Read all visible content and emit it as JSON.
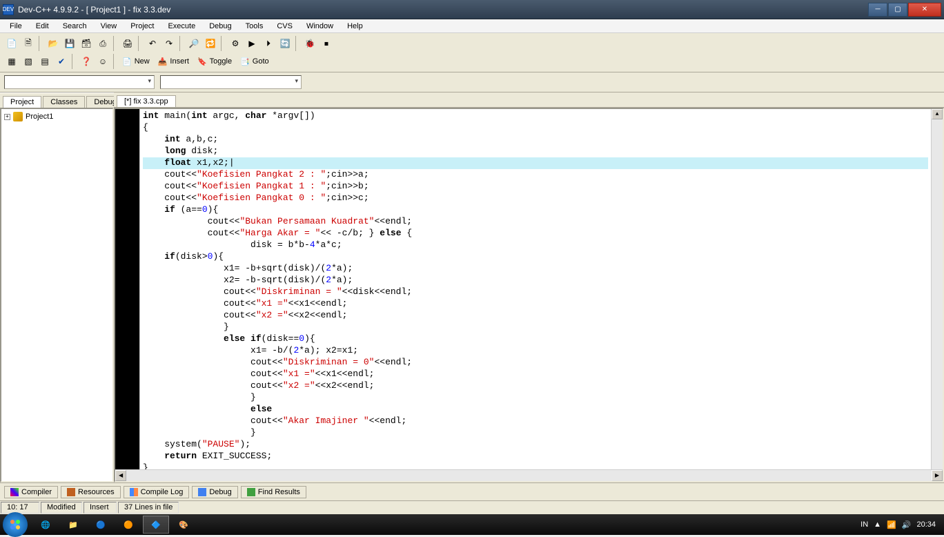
{
  "window": {
    "title": "Dev-C++ 4.9.9.2  - [ Project1 ] - fix 3.3.dev"
  },
  "menu": [
    "File",
    "Edit",
    "Search",
    "View",
    "Project",
    "Execute",
    "Debug",
    "Tools",
    "CVS",
    "Window",
    "Help"
  ],
  "toolbar2": {
    "new": "New",
    "insert": "Insert",
    "toggle": "Toggle",
    "goto": "Goto"
  },
  "sidetabs": [
    "Project",
    "Classes",
    "Debug"
  ],
  "project_tree": {
    "root": "Project1"
  },
  "editor_tab": "[*] fix 3.3.cpp",
  "code_lines": [
    {
      "h": false,
      "seg": [
        [
          "kw",
          "int"
        ],
        [
          "",
          ". main("
        ],
        [
          "kw",
          "int"
        ],
        [
          "",
          " argc, "
        ],
        [
          "kw",
          "char"
        ],
        [
          "",
          " *argv[])"
        ]
      ]
    },
    {
      "h": false,
      "seg": [
        [
          "",
          "{"
        ]
      ]
    },
    {
      "h": false,
      "seg": [
        [
          "",
          "    "
        ],
        [
          "kw",
          "int"
        ],
        [
          "",
          " a,b,c;"
        ]
      ]
    },
    {
      "h": false,
      "seg": [
        [
          "",
          "    "
        ],
        [
          "kw",
          "long"
        ],
        [
          "",
          " disk;"
        ]
      ]
    },
    {
      "h": true,
      "seg": [
        [
          "",
          "    "
        ],
        [
          "kw",
          "float"
        ],
        [
          "",
          " x1,x2;"
        ],
        [
          "",
          "|"
        ]
      ]
    },
    {
      "h": false,
      "seg": [
        [
          "",
          "    cout<<"
        ],
        [
          "str",
          "\"Koefisien Pangkat 2 : \""
        ],
        [
          "",
          ";cin>>a;"
        ]
      ]
    },
    {
      "h": false,
      "seg": [
        [
          "",
          "    cout<<"
        ],
        [
          "str",
          "\"Koefisien Pangkat 1 : \""
        ],
        [
          "",
          ";cin>>b;"
        ]
      ]
    },
    {
      "h": false,
      "seg": [
        [
          "",
          "    cout<<"
        ],
        [
          "str",
          "\"Koefisien Pangkat 0 : \""
        ],
        [
          "",
          ";cin>>c;"
        ]
      ]
    },
    {
      "h": false,
      "seg": [
        [
          "",
          "    "
        ],
        [
          "kw",
          "if"
        ],
        [
          "",
          " (a=="
        ],
        [
          "num",
          "0"
        ],
        [
          "",
          "){"
        ]
      ]
    },
    {
      "h": false,
      "seg": [
        [
          "",
          "            cout<<"
        ],
        [
          "str",
          "\"Bukan Persamaan Kuadrat\""
        ],
        [
          "",
          "<<endl;"
        ]
      ]
    },
    {
      "h": false,
      "seg": [
        [
          "",
          "            cout<<"
        ],
        [
          "str",
          "\"Harga Akar = \""
        ],
        [
          "",
          "<< -c/b; } "
        ],
        [
          "kw",
          "else"
        ],
        [
          "",
          " {"
        ]
      ]
    },
    {
      "h": false,
      "seg": [
        [
          "",
          "                    disk = b*b-"
        ],
        [
          "num",
          "4"
        ],
        [
          "",
          "*a*c;"
        ]
      ]
    },
    {
      "h": false,
      "seg": [
        [
          "",
          "    "
        ],
        [
          "kw",
          "if"
        ],
        [
          "",
          "(disk>"
        ],
        [
          "num",
          "0"
        ],
        [
          "",
          "){"
        ]
      ]
    },
    {
      "h": false,
      "seg": [
        [
          "",
          "               x1= -b+sqrt(disk)/("
        ],
        [
          "num",
          "2"
        ],
        [
          "",
          "*a);"
        ]
      ]
    },
    {
      "h": false,
      "seg": [
        [
          "",
          "               x2= -b-sqrt(disk)/("
        ],
        [
          "num",
          "2"
        ],
        [
          "",
          "*a);"
        ]
      ]
    },
    {
      "h": false,
      "seg": [
        [
          "",
          "               cout<<"
        ],
        [
          "str",
          "\"Diskriminan = \""
        ],
        [
          "",
          "<<disk<<endl;"
        ]
      ]
    },
    {
      "h": false,
      "seg": [
        [
          "",
          "               cout<<"
        ],
        [
          "str",
          "\"x1 =\""
        ],
        [
          "",
          "<<x1<<endl;"
        ]
      ]
    },
    {
      "h": false,
      "seg": [
        [
          "",
          "               cout<<"
        ],
        [
          "str",
          "\"x2 =\""
        ],
        [
          "",
          "<<x2<<endl;"
        ]
      ]
    },
    {
      "h": false,
      "seg": [
        [
          "",
          "               }"
        ]
      ]
    },
    {
      "h": false,
      "seg": [
        [
          "",
          "               "
        ],
        [
          "kw",
          "else"
        ],
        [
          "",
          " "
        ],
        [
          "kw",
          "if"
        ],
        [
          "",
          "(disk=="
        ],
        [
          "num",
          "0"
        ],
        [
          "",
          "){"
        ]
      ]
    },
    {
      "h": false,
      "seg": [
        [
          "",
          "                    x1= -b/("
        ],
        [
          "num",
          "2"
        ],
        [
          "",
          "*a); x2=x1;"
        ]
      ]
    },
    {
      "h": false,
      "seg": [
        [
          "",
          "                    cout<<"
        ],
        [
          "str",
          "\"Diskriminan = 0\""
        ],
        [
          "",
          "<<endl;"
        ]
      ]
    },
    {
      "h": false,
      "seg": [
        [
          "",
          "                    cout<<"
        ],
        [
          "str",
          "\"x1 =\""
        ],
        [
          "",
          "<<x1<<endl;"
        ]
      ]
    },
    {
      "h": false,
      "seg": [
        [
          "",
          "                    cout<<"
        ],
        [
          "str",
          "\"x2 =\""
        ],
        [
          "",
          "<<x2<<endl;"
        ]
      ]
    },
    {
      "h": false,
      "seg": [
        [
          "",
          "                    }"
        ]
      ]
    },
    {
      "h": false,
      "seg": [
        [
          "",
          "                    "
        ],
        [
          "kw",
          "else"
        ]
      ]
    },
    {
      "h": false,
      "seg": [
        [
          "",
          "                    cout<<"
        ],
        [
          "str",
          "\"Akar Imajiner \""
        ],
        [
          "",
          "<<endl;"
        ]
      ]
    },
    {
      "h": false,
      "seg": [
        [
          "",
          "                    }"
        ]
      ]
    },
    {
      "h": false,
      "seg": [
        [
          "",
          "    system("
        ],
        [
          "str",
          "\"PAUSE\""
        ],
        [
          "",
          ");"
        ]
      ]
    },
    {
      "h": false,
      "seg": [
        [
          "",
          "    "
        ],
        [
          "kw",
          "return"
        ],
        [
          "",
          " EXIT_SUCCESS;"
        ]
      ]
    },
    {
      "h": false,
      "seg": [
        [
          "",
          "}"
        ]
      ]
    }
  ],
  "bottom_tabs": [
    "Compiler",
    "Resources",
    "Compile Log",
    "Debug",
    "Find Results"
  ],
  "status": {
    "pos": "10: 17",
    "modified": "Modified",
    "mode": "Insert",
    "lines": "37 Lines in file"
  },
  "tray": {
    "lang": "IN",
    "time": "20:34"
  }
}
